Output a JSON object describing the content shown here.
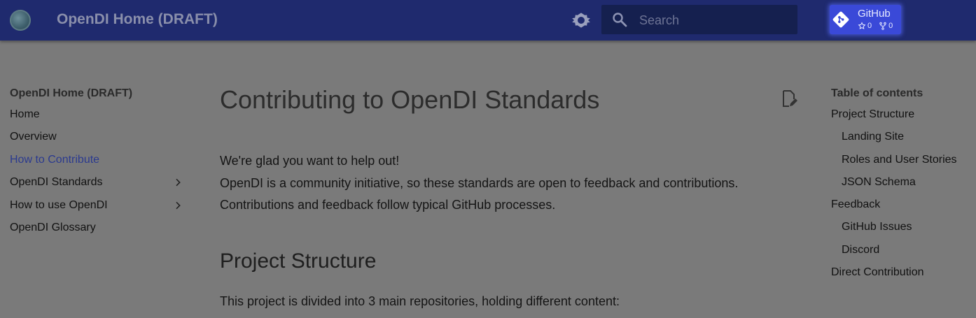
{
  "header": {
    "site_title": "OpenDI Home (DRAFT)",
    "search_placeholder": "Search",
    "repo": {
      "name": "GitHub",
      "stars": "0",
      "forks": "0"
    }
  },
  "nav": {
    "title": "OpenDI Home (DRAFT)",
    "items": [
      {
        "label": "Home"
      },
      {
        "label": "Overview"
      },
      {
        "label": "How to Contribute",
        "active": true
      },
      {
        "label": "OpenDI Standards",
        "expandable": true
      },
      {
        "label": "How to use OpenDI",
        "expandable": true
      },
      {
        "label": "OpenDI Glossary"
      }
    ]
  },
  "main": {
    "title": "Contributing to OpenDI Standards",
    "intro": [
      "We're glad you want to help out!",
      "OpenDI is a community initiative, so these standards are open to feedback and contributions.",
      "Contributions and feedback follow typical GitHub processes."
    ],
    "section_heading": "Project Structure",
    "section_text": "This project is divided into 3 main repositories, holding different content:"
  },
  "toc": {
    "title": "Table of contents",
    "items": [
      {
        "label": "Project Structure",
        "level": 1
      },
      {
        "label": "Landing Site",
        "level": 2
      },
      {
        "label": "Roles and User Stories",
        "level": 2
      },
      {
        "label": "JSON Schema",
        "level": 2
      },
      {
        "label": "Feedback",
        "level": 1
      },
      {
        "label": "GitHub Issues",
        "level": 2
      },
      {
        "label": "Discord",
        "level": 2
      },
      {
        "label": "Direct Contribution",
        "level": 1
      }
    ]
  },
  "colors": {
    "header_bg": "#1f2a6e",
    "page_overlay": "#7a7a7a",
    "active_link": "#2b3a8f",
    "repo_accent": "#3a49d8"
  }
}
